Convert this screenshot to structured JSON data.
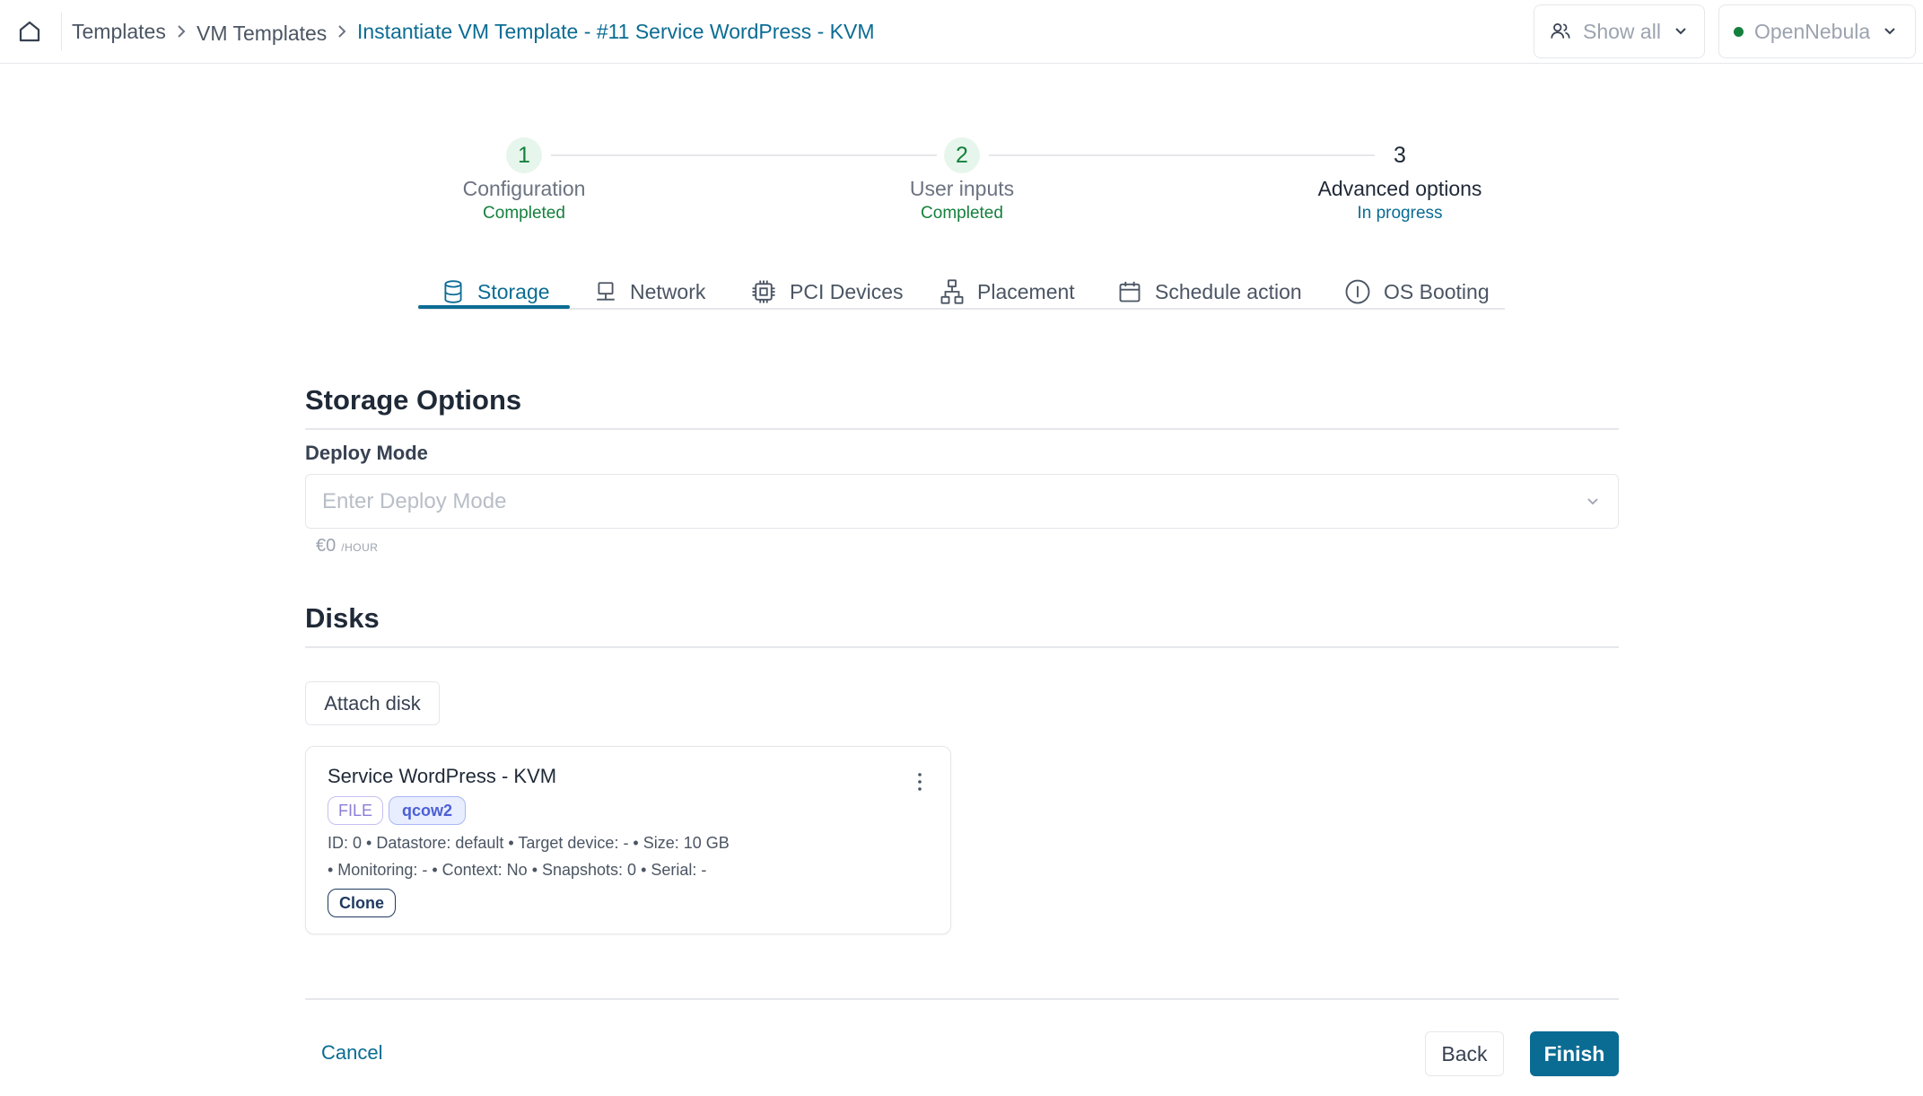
{
  "breadcrumb": {
    "items": [
      "Templates",
      "VM Templates"
    ],
    "current": "Instantiate VM Template - #11 Service WordPress - KVM"
  },
  "header": {
    "filter_label": "Show all",
    "zone_label": "OpenNebula",
    "zone_status_color": "#15803d"
  },
  "stepper": [
    {
      "number": "1",
      "title": "Configuration",
      "status": "Completed"
    },
    {
      "number": "2",
      "title": "User inputs",
      "status": "Completed"
    },
    {
      "number": "3",
      "title": "Advanced options",
      "status": "In progress"
    }
  ],
  "tabs": [
    {
      "label": "Storage",
      "icon": "database-icon",
      "active": true
    },
    {
      "label": "Network",
      "icon": "network-icon"
    },
    {
      "label": "PCI Devices",
      "icon": "chip-icon"
    },
    {
      "label": "Placement",
      "icon": "hierarchy-icon"
    },
    {
      "label": "Schedule action",
      "icon": "calendar-icon"
    },
    {
      "label": "OS Booting",
      "icon": "info-icon"
    }
  ],
  "storage_options": {
    "title": "Storage Options",
    "deploy_mode_label": "Deploy Mode",
    "deploy_mode_placeholder": "Enter Deploy Mode",
    "price": "€0",
    "price_unit": "/HOUR"
  },
  "disks": {
    "title": "Disks",
    "attach_label": "Attach disk",
    "items": [
      {
        "name": "Service WordPress - KVM",
        "tags": [
          "FILE",
          "qcow2"
        ],
        "meta_line1": "ID: 0  •  Datastore: default  •  Target device: -  •  Size: 10 GB",
        "meta_line2": "•  Monitoring: -  •  Context: No  •  Snapshots: 0  •  Serial: -",
        "badge": "Clone"
      }
    ]
  },
  "footer": {
    "cancel_label": "Cancel",
    "back_label": "Back",
    "finish_label": "Finish"
  },
  "colors": {
    "accent": "#0b6c93",
    "success": "#15803d"
  }
}
